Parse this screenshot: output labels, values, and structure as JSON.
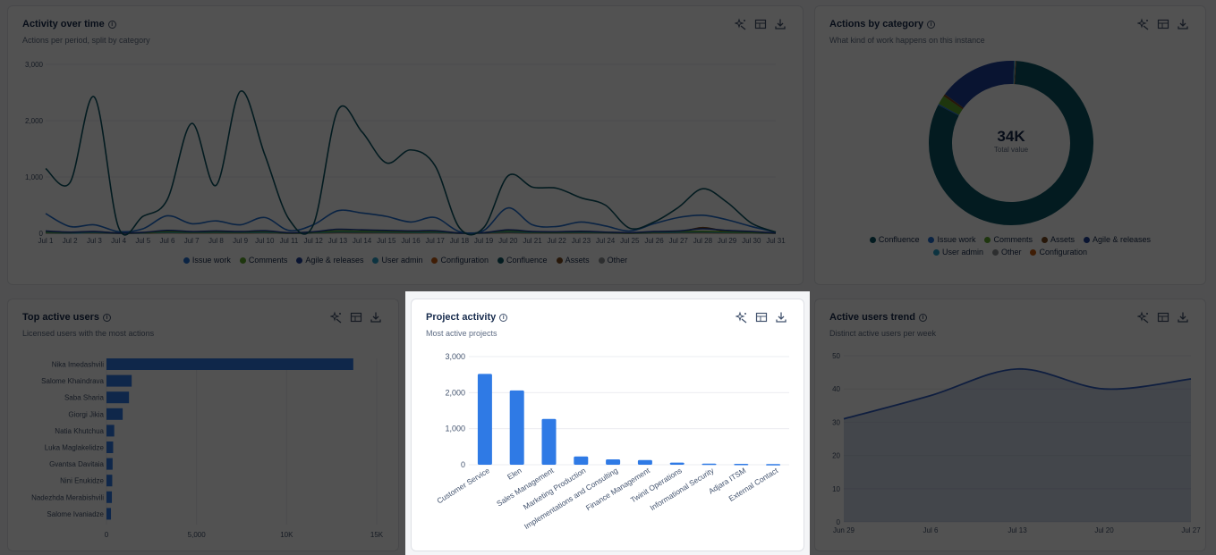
{
  "colors": {
    "issue_work": "#1f6fd1",
    "comments": "#5fa82e",
    "agile_releases": "#1d3f9a",
    "user_admin": "#26a0c8",
    "configuration": "#c55a12",
    "confluence": "#0b5563",
    "assets": "#7a4a1c",
    "other": "#8c8f94",
    "bar": "#2f7ae5"
  },
  "icons": {
    "toolbar": [
      "sparkle-icon",
      "table-icon",
      "download-icon"
    ],
    "info": "info-icon"
  },
  "cards": {
    "activity": {
      "title": "Activity over time",
      "subtitle": "Actions per period, split by category"
    },
    "category": {
      "title": "Actions by category",
      "subtitle": "What kind of work happens on this instance"
    },
    "users": {
      "title": "Top active users",
      "subtitle": "Licensed users with the most actions"
    },
    "projects": {
      "title": "Project activity",
      "subtitle": "Most active projects"
    },
    "trend": {
      "title": "Active users trend",
      "subtitle": "Distinct active users per week"
    }
  },
  "chart_data": [
    {
      "id": "activity",
      "type": "line",
      "title": "Activity over time",
      "x": [
        "Jul 1",
        "Jul 2",
        "Jul 3",
        "Jul 4",
        "Jul 5",
        "Jul 6",
        "Jul 7",
        "Jul 8",
        "Jul 9",
        "Jul 10",
        "Jul 11",
        "Jul 12",
        "Jul 13",
        "Jul 14",
        "Jul 15",
        "Jul 16",
        "Jul 17",
        "Jul 18",
        "Jul 19",
        "Jul 20",
        "Jul 21",
        "Jul 22",
        "Jul 23",
        "Jul 24",
        "Jul 25",
        "Jul 26",
        "Jul 27",
        "Jul 28",
        "Jul 29",
        "Jul 30",
        "Jul 31"
      ],
      "ylim": [
        0,
        3000
      ],
      "yticks": [
        "0",
        "1,000",
        "2,000",
        "3,000"
      ],
      "grid": true,
      "legend_position": "bottom",
      "series": [
        {
          "name": "Issue work",
          "values": [
            350,
            120,
            150,
            30,
            80,
            310,
            170,
            220,
            150,
            280,
            50,
            150,
            400,
            360,
            300,
            200,
            280,
            30,
            50,
            450,
            150,
            120,
            200,
            130,
            40,
            170,
            280,
            320,
            240,
            120,
            20
          ]
        },
        {
          "name": "Comments",
          "values": [
            20,
            15,
            25,
            5,
            10,
            30,
            20,
            25,
            20,
            30,
            5,
            15,
            40,
            35,
            30,
            25,
            30,
            5,
            10,
            40,
            20,
            15,
            25,
            15,
            5,
            20,
            30,
            35,
            25,
            15,
            5
          ]
        },
        {
          "name": "Agile & releases",
          "values": [
            40,
            20,
            30,
            5,
            15,
            50,
            30,
            40,
            30,
            45,
            10,
            25,
            70,
            60,
            50,
            40,
            45,
            5,
            10,
            60,
            30,
            25,
            35,
            20,
            10,
            30,
            40,
            80,
            50,
            30,
            5
          ]
        },
        {
          "name": "User admin",
          "values": [
            10,
            5,
            10,
            2,
            5,
            15,
            10,
            12,
            10,
            15,
            3,
            8,
            20,
            18,
            15,
            12,
            15,
            2,
            5,
            20,
            10,
            8,
            12,
            8,
            3,
            10,
            15,
            18,
            12,
            8,
            2
          ]
        },
        {
          "name": "Configuration",
          "values": [
            5,
            3,
            5,
            1,
            2,
            8,
            5,
            6,
            5,
            8,
            1,
            4,
            10,
            9,
            8,
            6,
            8,
            1,
            2,
            10,
            5,
            4,
            6,
            4,
            1,
            5,
            8,
            9,
            6,
            4,
            1
          ]
        },
        {
          "name": "Confluence",
          "values": [
            1150,
            900,
            2420,
            100,
            300,
            600,
            1950,
            850,
            2520,
            1400,
            250,
            150,
            2180,
            1800,
            1250,
            1480,
            1200,
            100,
            100,
            1020,
            820,
            800,
            630,
            500,
            90,
            200,
            460,
            790,
            550,
            180,
            20
          ]
        },
        {
          "name": "Assets",
          "values": [
            15,
            10,
            15,
            3,
            8,
            20,
            15,
            18,
            15,
            20,
            4,
            10,
            30,
            25,
            20,
            18,
            20,
            3,
            6,
            30,
            15,
            12,
            18,
            12,
            4,
            15,
            20,
            100,
            30,
            15,
            3
          ]
        },
        {
          "name": "Other",
          "values": [
            5,
            3,
            5,
            1,
            3,
            8,
            5,
            6,
            5,
            8,
            1,
            4,
            10,
            9,
            8,
            6,
            8,
            1,
            2,
            10,
            5,
            4,
            6,
            4,
            1,
            5,
            8,
            10,
            6,
            4,
            1
          ]
        }
      ]
    },
    {
      "id": "category",
      "type": "pie",
      "title": "Actions by category",
      "center_value": "34K",
      "center_label": "Total value",
      "legend_position": "bottom",
      "categories": [
        "Confluence",
        "Issue work",
        "Comments",
        "Assets",
        "Agile & releases",
        "User admin",
        "Other",
        "Configuration"
      ],
      "values": [
        27500,
        80,
        600,
        150,
        5200,
        60,
        40,
        30
      ]
    },
    {
      "id": "users",
      "type": "bar",
      "orientation": "horizontal",
      "title": "Top active users",
      "categories": [
        "Nika Imedashvili",
        "Salome Khaindrava",
        "Saba Sharia",
        "Giorgi Jikia",
        "Natia Khutchua",
        "Luka Maglakelidze",
        "Gvantsa Davitaia",
        "Nini Enukidze",
        "Nadezhda Merabishvili",
        "Salome Ivaniadze"
      ],
      "values": [
        13700,
        1400,
        1250,
        900,
        430,
        370,
        340,
        320,
        300,
        250
      ],
      "xlim": [
        0,
        15000
      ],
      "xticks": [
        "0",
        "5,000",
        "10K",
        "15K"
      ]
    },
    {
      "id": "projects",
      "type": "bar",
      "title": "Project activity",
      "categories": [
        "Customer Service",
        "Elen",
        "Sales Management",
        "Marketing Production",
        "Implementations and Consulting",
        "Finance Management",
        "Twinit Operations",
        "Informational Security",
        "Adjara ITSM",
        "External Contact"
      ],
      "values": [
        2520,
        2060,
        1270,
        230,
        150,
        130,
        60,
        30,
        25,
        20
      ],
      "ylim": [
        0,
        3000
      ],
      "yticks": [
        "0",
        "1,000",
        "2,000",
        "3,000"
      ]
    },
    {
      "id": "trend",
      "type": "area",
      "title": "Active users trend",
      "x": [
        "Jun 29",
        "Jul 6",
        "Jul 13",
        "Jul 20",
        "Jul 27"
      ],
      "values": [
        31,
        38,
        46,
        40,
        43
      ],
      "ylim": [
        0,
        50
      ],
      "yticks": [
        "0",
        "10",
        "20",
        "30",
        "40",
        "50"
      ]
    }
  ]
}
